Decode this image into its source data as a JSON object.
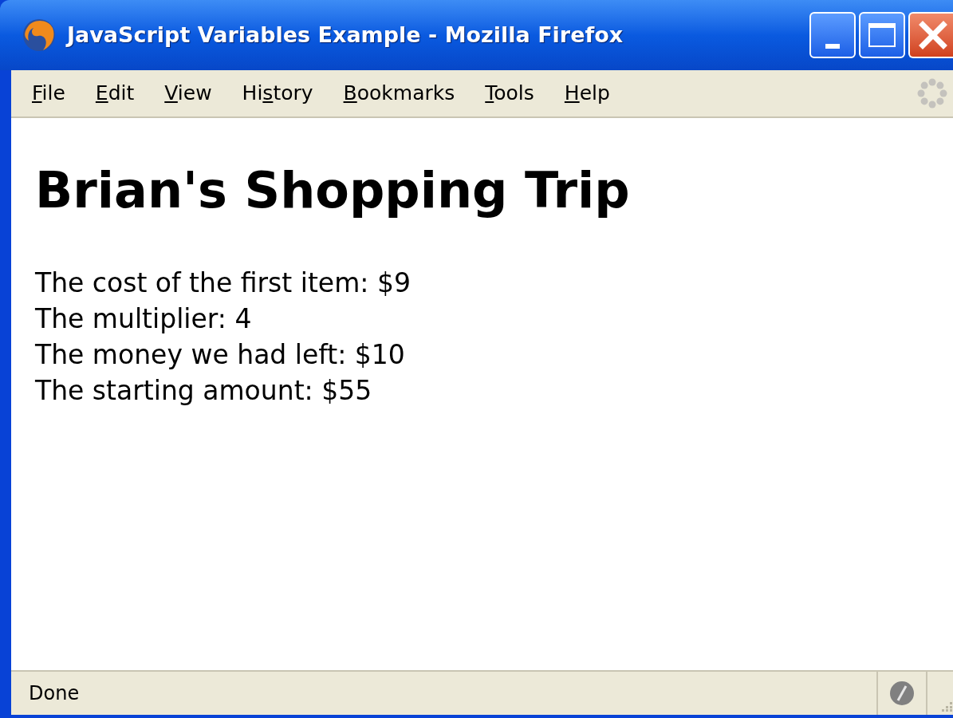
{
  "window": {
    "title": "JavaScript Variables Example - Mozilla Firefox"
  },
  "menu": [
    {
      "key": "F",
      "post": "ile"
    },
    {
      "key": "E",
      "post": "dit"
    },
    {
      "key": "V",
      "post": "iew"
    },
    {
      "pre": "Hi",
      "key": "s",
      "post": "tory"
    },
    {
      "key": "B",
      "post": "ookmarks"
    },
    {
      "key": "T",
      "post": "ools"
    },
    {
      "key": "H",
      "post": "elp"
    }
  ],
  "page": {
    "heading": "Brian's Shopping Trip",
    "lines": [
      "The cost of the first item: $9",
      "The multiplier: 4",
      "The money we had left: $10",
      "The starting amount: $55"
    ]
  },
  "status_bar": {
    "text": "Done"
  }
}
